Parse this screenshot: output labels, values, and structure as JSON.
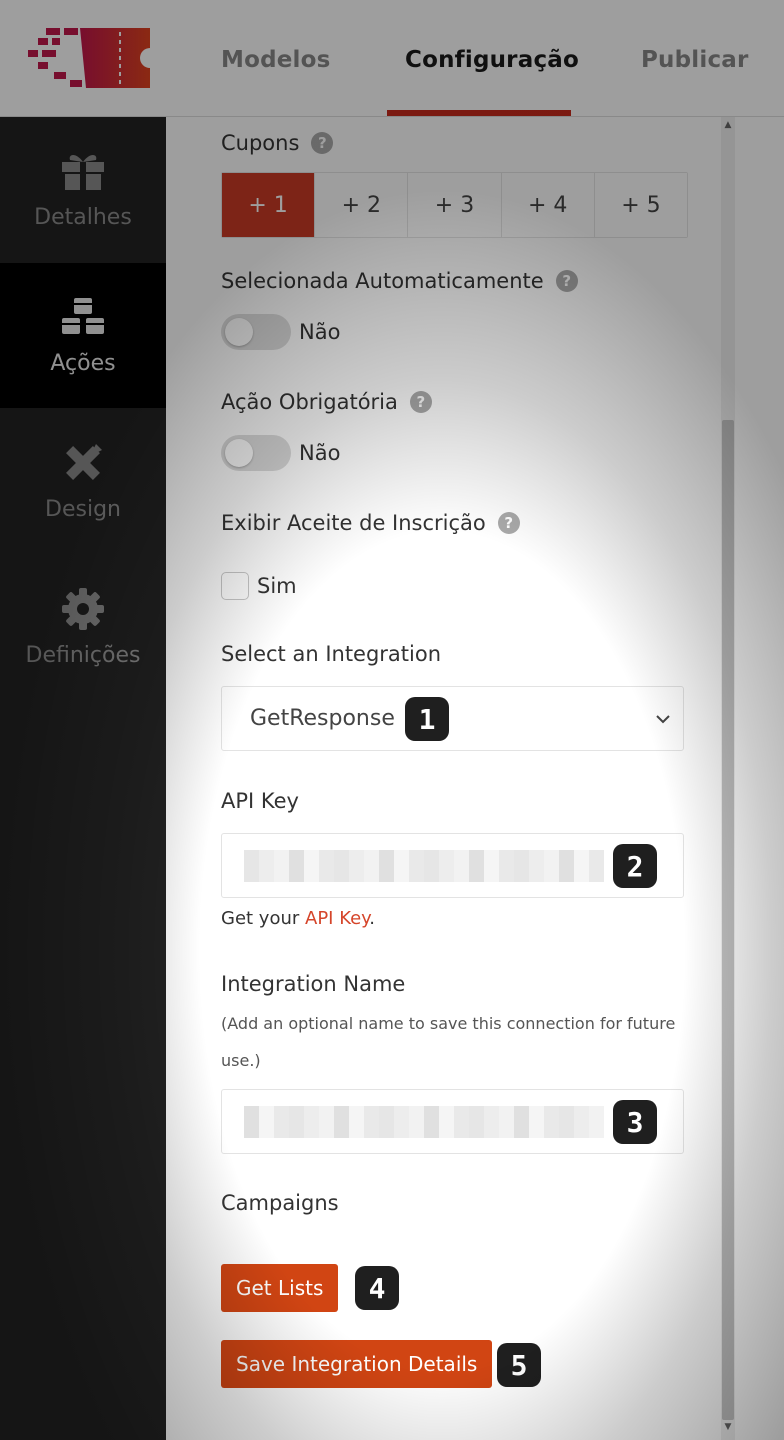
{
  "header": {
    "tabs": [
      {
        "label": "Modelos"
      },
      {
        "label": "Configuração"
      },
      {
        "label": "Publicar"
      }
    ],
    "active_tab": "Configuração"
  },
  "sidebar": {
    "items": [
      {
        "label": "Detalhes",
        "icon": "gift-icon"
      },
      {
        "label": "Ações",
        "icon": "cubes-icon"
      },
      {
        "label": "Design",
        "icon": "pencil-ruler-icon"
      },
      {
        "label": "Definições",
        "icon": "gear-icon"
      }
    ],
    "active_item": "Ações"
  },
  "form": {
    "coupons": {
      "label": "Cupons",
      "options": [
        "+ 1",
        "+ 2",
        "+ 3",
        "+ 4",
        "+ 5"
      ],
      "selected": "+ 1"
    },
    "auto_selected": {
      "label": "Selecionada Automaticamente",
      "value": "Não"
    },
    "mandatory": {
      "label": "Ação Obrigatória",
      "value": "Não"
    },
    "subscription": {
      "label": "Exibir Aceite de Inscrição",
      "checkbox_label": "Sim",
      "checked": false
    },
    "integration": {
      "label": "Select an Integration",
      "value": "GetResponse"
    },
    "api_key": {
      "label": "API Key",
      "helper_prefix": "Get your ",
      "helper_link": "API Key",
      "helper_suffix": "."
    },
    "integration_name": {
      "label": "Integration Name",
      "note": "(Add an optional name to save this connection for future use.)"
    },
    "campaigns": {
      "label": "Campaigns"
    },
    "get_lists_label": "Get Lists",
    "save_label": "Save Integration Details"
  },
  "badges": [
    "1",
    "2",
    "3",
    "4",
    "5"
  ],
  "help_glyph": "?",
  "colors": {
    "accent": "#c93a25",
    "button": "#d14513",
    "sidebar_bg": "#222222",
    "sidebar_active": "#000000",
    "link": "#d5452a"
  }
}
